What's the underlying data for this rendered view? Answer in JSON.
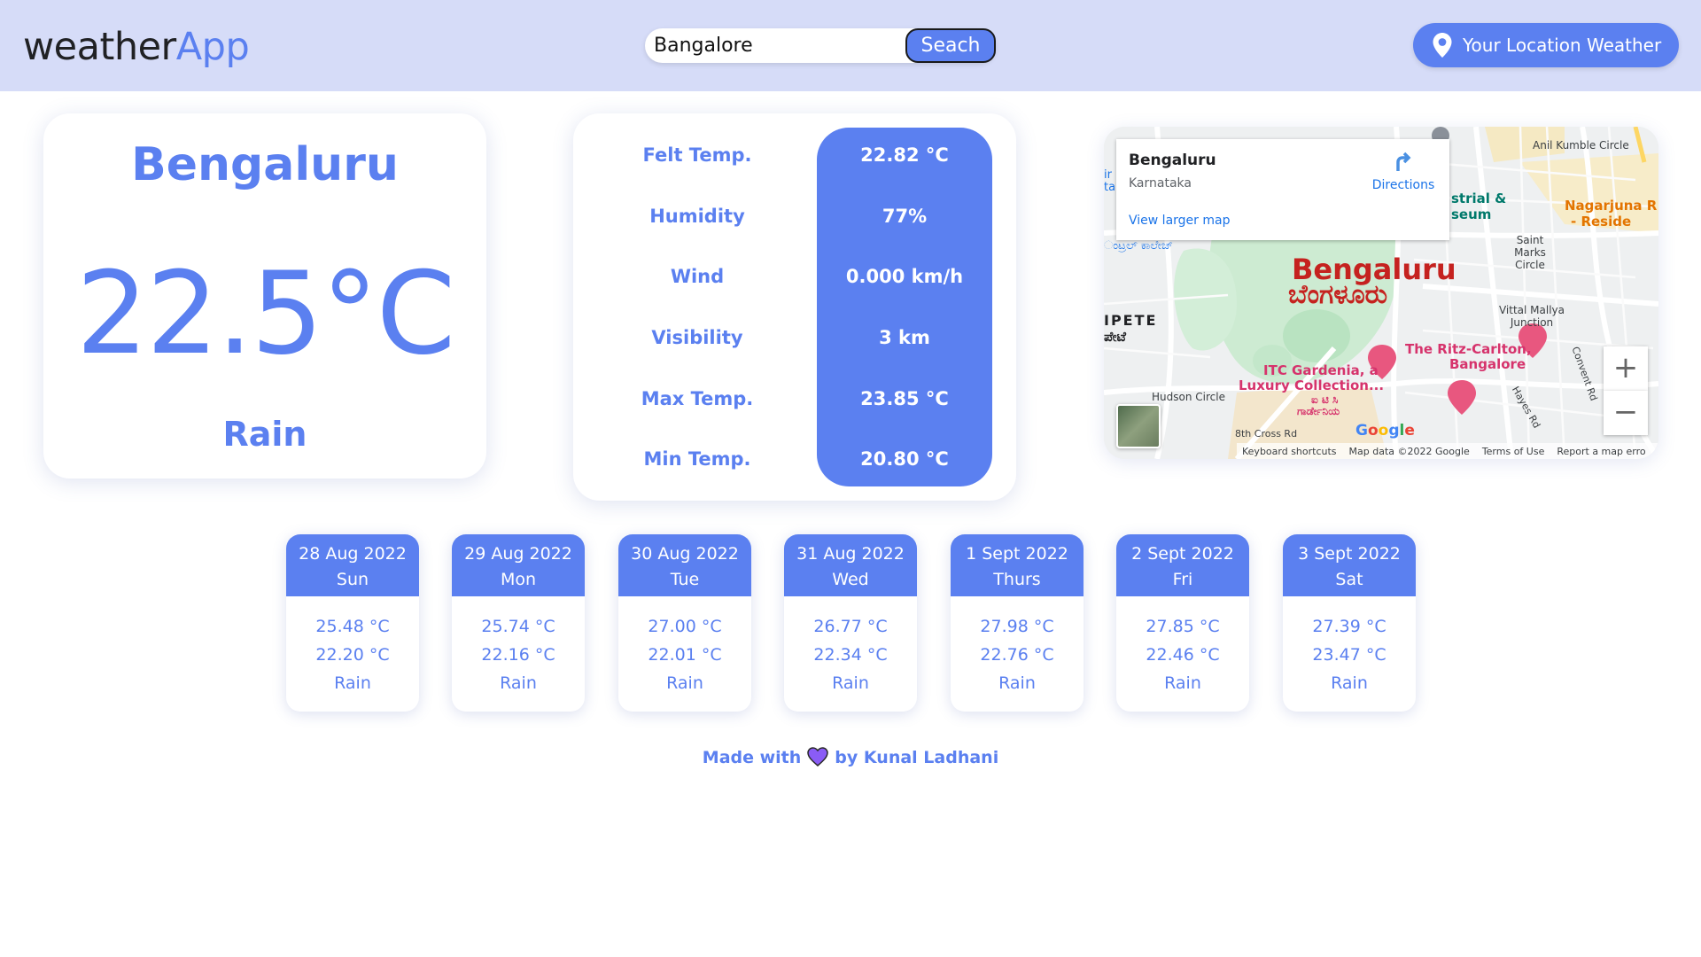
{
  "header": {
    "logo_part1": "weather",
    "logo_part2": "App",
    "search": {
      "value": "Bangalore",
      "button_label": "Seach"
    },
    "location_button_label": "Your Location Weather"
  },
  "current": {
    "city": "Bengaluru",
    "temperature": "22.5°C",
    "condition": "Rain"
  },
  "details": [
    {
      "label": "Felt Temp.",
      "value": "22.82 °C"
    },
    {
      "label": "Humidity",
      "value": "77%"
    },
    {
      "label": "Wind",
      "value": "0.000 km/h"
    },
    {
      "label": "Visibility",
      "value": "3 km"
    },
    {
      "label": "Max Temp.",
      "value": "23.85 °C"
    },
    {
      "label": "Min Temp.",
      "value": "20.80 °C"
    }
  ],
  "map": {
    "place_name": "Bengaluru",
    "place_region": "Karnataka",
    "directions_label": "Directions",
    "larger_map_link": "View larger map",
    "city_label": "Bengaluru",
    "city_label_kannada": "ಬೆಂಗಳೂರು",
    "labels": {
      "anil_kumble": "Anil Kumble Circle",
      "nagarjuna": "Nagarjuna R",
      "reside": "- Reside",
      "museum_1": "strial &",
      "museum_2": "seum",
      "saint_marks": "Saint Marks Circle",
      "vittal_mallya": "Vittal Mallya Junction",
      "ritz_1": "The Ritz-Carlton,",
      "ritz_2": "Bangalore",
      "itc_1": "ITC Gardenia, a",
      "itc_2": "Luxury Collection...",
      "itc_kn_1": "ಐ ಟಿ ಸಿ",
      "itc_kn_2": "ಗಾರ್ಡೇನಿಯ",
      "hudson": "Hudson Circle",
      "pete": "IPETE",
      "pete_kn": "ಪೇಟೆ",
      "college_kn": "ಂಟ್ರಲ್ ಕಾಲೇಜ್",
      "cross_rd": "8th Cross Rd",
      "convent_rd": "Convent Rd",
      "hayes_rd": "Hayes Rd",
      "left_edge_1": "ir",
      "left_edge_2": "ta",
      "google": "Google"
    },
    "zoom_in": "+",
    "zoom_out": "−",
    "footer": {
      "shortcuts": "Keyboard shortcuts",
      "map_data": "Map data ©2022 Google",
      "terms": "Terms of Use",
      "report": "Report a map erro"
    }
  },
  "forecast": [
    {
      "date": "28 Aug 2022",
      "day": "Sun",
      "max": "25.48 °C",
      "min": "22.20 °C",
      "cond": "Rain"
    },
    {
      "date": "29 Aug 2022",
      "day": "Mon",
      "max": "25.74 °C",
      "min": "22.16 °C",
      "cond": "Rain"
    },
    {
      "date": "30 Aug 2022",
      "day": "Tue",
      "max": "27.00 °C",
      "min": "22.01 °C",
      "cond": "Rain"
    },
    {
      "date": "31 Aug 2022",
      "day": "Wed",
      "max": "26.77 °C",
      "min": "22.34 °C",
      "cond": "Rain"
    },
    {
      "date": "1 Sept 2022",
      "day": "Thurs",
      "max": "27.98 °C",
      "min": "22.76 °C",
      "cond": "Rain"
    },
    {
      "date": "2 Sept 2022",
      "day": "Fri",
      "max": "27.85 °C",
      "min": "22.46 °C",
      "cond": "Rain"
    },
    {
      "date": "3 Sept 2022",
      "day": "Sat",
      "max": "27.39 °C",
      "min": "23.47 °C",
      "cond": "Rain"
    }
  ],
  "footer": {
    "made_with": "Made with",
    "by": "by Kunal Ladhani"
  },
  "colors": {
    "accent": "#5b80f0",
    "header_bg": "#d6dcf8",
    "heart": "#8a5cf5"
  }
}
